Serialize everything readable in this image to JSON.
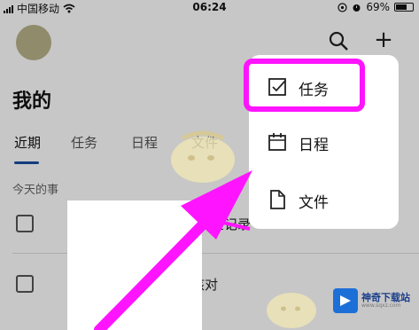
{
  "status_bar": {
    "carrier": "中国移动",
    "time": "06:24",
    "battery": "69%"
  },
  "header": {
    "title": "我的",
    "avatar_text": "",
    "search_icon": "search-icon",
    "add_icon": "plus-icon",
    "add_glyph": "+"
  },
  "tabs": [
    {
      "label": "近期",
      "active": true
    },
    {
      "label": "任务",
      "active": false
    },
    {
      "label": "日程",
      "active": false
    },
    {
      "label": "文件",
      "active": false
    }
  ],
  "section": {
    "title": "今天的事"
  },
  "tasks": [
    {
      "text": "查记录"
    },
    {
      "text": "核对"
    }
  ],
  "menu": {
    "items": [
      {
        "label": "任务",
        "icon": "task-checkbox-icon"
      },
      {
        "label": "日程",
        "icon": "calendar-icon"
      },
      {
        "label": "文件",
        "icon": "file-icon"
      }
    ]
  },
  "annotation": {
    "highlight_color": "#ff14ff",
    "arrow_color": "#ff14ff"
  },
  "watermark": {
    "name": "神奇下载站",
    "url": "www.sqxz.com"
  },
  "colors": {
    "accent": "#1a4fa0",
    "avatar": "#b9b28a",
    "dim": "rgba(0,0,0,0.22)"
  }
}
